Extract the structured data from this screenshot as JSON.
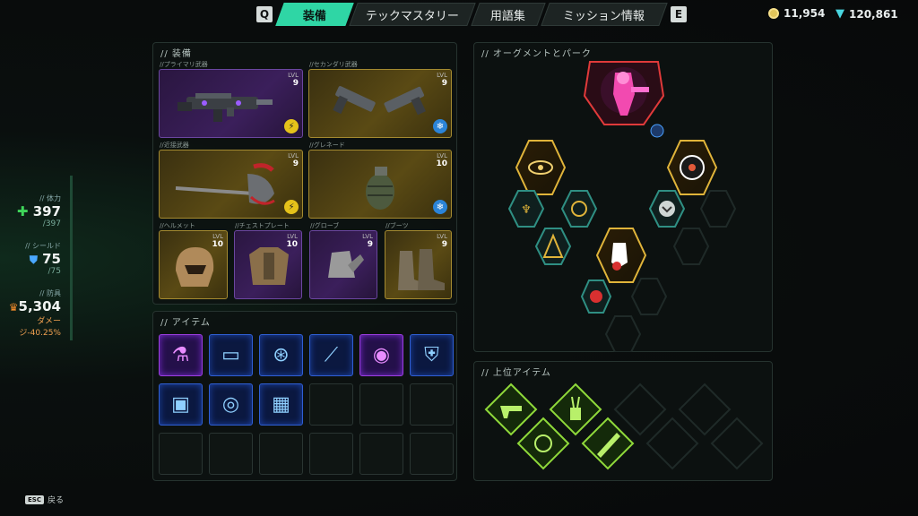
{
  "tabs": {
    "left_key": "Q",
    "right_key": "E",
    "items": [
      {
        "label": "装備",
        "active": true
      },
      {
        "label": "テックマスタリー",
        "active": false
      },
      {
        "label": "用語集",
        "active": false
      },
      {
        "label": "ミッション情報",
        "active": false
      }
    ]
  },
  "currency": {
    "coins": "11,954",
    "gems": "120,861"
  },
  "stats": {
    "health": {
      "label": "// 体力",
      "value": "397",
      "sub": "/397"
    },
    "shield": {
      "label": "// シールド",
      "value": "75",
      "sub": "/75"
    },
    "armor": {
      "label": "// 防具",
      "value": "5,304",
      "sub1": "ダメー",
      "sub2": "ジ-40.25%"
    }
  },
  "equipment": {
    "title": "// 装備",
    "lvl_label": "LVL",
    "slots": [
      {
        "label": "//プライマリ武器",
        "level": "9",
        "rarity": "purple",
        "badge": "lightning"
      },
      {
        "label": "//セカンダリ武器",
        "level": "9",
        "rarity": "gold",
        "badge": "frost"
      },
      {
        "label": "//近接武器",
        "level": "9",
        "rarity": "gold",
        "badge": "lightning"
      },
      {
        "label": "//グレネード",
        "level": "10",
        "rarity": "gold",
        "badge": "frost"
      },
      {
        "label": "//ヘルメット",
        "level": "10",
        "rarity": "gold"
      },
      {
        "label": "//チェストプレート",
        "level": "10",
        "rarity": "purple"
      },
      {
        "label": "//グローブ",
        "level": "9",
        "rarity": "purple"
      },
      {
        "label": "//ブーツ",
        "level": "9",
        "rarity": "gold"
      }
    ]
  },
  "items": {
    "title": "// アイテム",
    "cells": [
      {
        "icon": "flask-icon",
        "rarity": "pur"
      },
      {
        "icon": "cartridge-icon",
        "rarity": "blue"
      },
      {
        "icon": "knuckles-icon",
        "rarity": "blue"
      },
      {
        "icon": "syringe-icon",
        "rarity": "blue"
      },
      {
        "icon": "eye-core-icon",
        "rarity": "pur"
      },
      {
        "icon": "shield-crest-icon",
        "rarity": "blue"
      },
      {
        "icon": "battery-icon",
        "rarity": "blue"
      },
      {
        "icon": "target-core-icon",
        "rarity": "blue"
      },
      {
        "icon": "chest-icon",
        "rarity": "blue"
      },
      {
        "icon": "",
        "rarity": "empty"
      },
      {
        "icon": "",
        "rarity": "empty"
      },
      {
        "icon": "",
        "rarity": "empty"
      },
      {
        "icon": "",
        "rarity": "empty"
      },
      {
        "icon": "",
        "rarity": "empty"
      },
      {
        "icon": "",
        "rarity": "empty"
      },
      {
        "icon": "",
        "rarity": "empty"
      },
      {
        "icon": "",
        "rarity": "empty"
      },
      {
        "icon": "",
        "rarity": "empty"
      }
    ]
  },
  "augments": {
    "title": "// オーグメントとパーク"
  },
  "top_items": {
    "title": "// 上位アイテム"
  },
  "footer": {
    "esc_key": "ESC",
    "back_label": "戻る"
  },
  "colors": {
    "accent": "#2fd6a5",
    "gold": "#e0b43a",
    "teal": "#2f8f83",
    "purple": "#9b3ee0"
  }
}
